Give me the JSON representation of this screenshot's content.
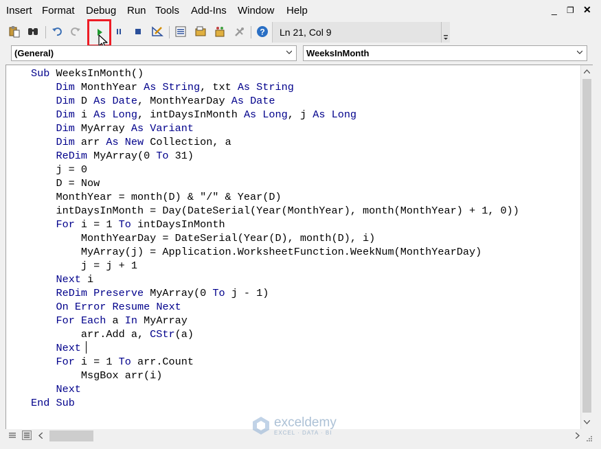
{
  "menu": {
    "items": [
      "Insert",
      "Format",
      "Debug",
      "Run",
      "Tools",
      "Add-Ins",
      "Window",
      "Help"
    ]
  },
  "window_controls": [
    "_",
    "▫",
    "✕"
  ],
  "toolbar": {
    "icons": [
      "paste-icon",
      "find-icon",
      "undo-icon",
      "redo-icon",
      "run-icon",
      "pause-icon",
      "reset-icon",
      "design-mode-icon",
      "project-explorer-icon",
      "properties-icon",
      "object-browser-icon",
      "toolbox-icon",
      "help-icon"
    ],
    "position": "Ln 21, Col 9",
    "highlight_color": "#ee1c25"
  },
  "combos": {
    "object": "(General)",
    "procedure": "WeeksInMonth"
  },
  "code": {
    "keyword_color": "#00008b",
    "lines": [
      [
        {
          "k": 1,
          "t": "Sub"
        },
        {
          "k": 0,
          "t": " WeeksInMonth()"
        }
      ],
      [
        {
          "k": 0,
          "t": "    "
        },
        {
          "k": 1,
          "t": "Dim"
        },
        {
          "k": 0,
          "t": " MonthYear "
        },
        {
          "k": 1,
          "t": "As"
        },
        {
          "k": 0,
          "t": " "
        },
        {
          "k": 1,
          "t": "String"
        },
        {
          "k": 0,
          "t": ", txt "
        },
        {
          "k": 1,
          "t": "As"
        },
        {
          "k": 0,
          "t": " "
        },
        {
          "k": 1,
          "t": "String"
        }
      ],
      [
        {
          "k": 0,
          "t": "    "
        },
        {
          "k": 1,
          "t": "Dim"
        },
        {
          "k": 0,
          "t": " D "
        },
        {
          "k": 1,
          "t": "As"
        },
        {
          "k": 0,
          "t": " "
        },
        {
          "k": 1,
          "t": "Date"
        },
        {
          "k": 0,
          "t": ", MonthYearDay "
        },
        {
          "k": 1,
          "t": "As"
        },
        {
          "k": 0,
          "t": " "
        },
        {
          "k": 1,
          "t": "Date"
        }
      ],
      [
        {
          "k": 0,
          "t": "    "
        },
        {
          "k": 1,
          "t": "Dim"
        },
        {
          "k": 0,
          "t": " i "
        },
        {
          "k": 1,
          "t": "As"
        },
        {
          "k": 0,
          "t": " "
        },
        {
          "k": 1,
          "t": "Long"
        },
        {
          "k": 0,
          "t": ", intDaysInMonth "
        },
        {
          "k": 1,
          "t": "As"
        },
        {
          "k": 0,
          "t": " "
        },
        {
          "k": 1,
          "t": "Long"
        },
        {
          "k": 0,
          "t": ", j "
        },
        {
          "k": 1,
          "t": "As"
        },
        {
          "k": 0,
          "t": " "
        },
        {
          "k": 1,
          "t": "Long"
        }
      ],
      [
        {
          "k": 0,
          "t": "    "
        },
        {
          "k": 1,
          "t": "Dim"
        },
        {
          "k": 0,
          "t": " MyArray "
        },
        {
          "k": 1,
          "t": "As"
        },
        {
          "k": 0,
          "t": " "
        },
        {
          "k": 1,
          "t": "Variant"
        }
      ],
      [
        {
          "k": 0,
          "t": "    "
        },
        {
          "k": 1,
          "t": "Dim"
        },
        {
          "k": 0,
          "t": " arr "
        },
        {
          "k": 1,
          "t": "As"
        },
        {
          "k": 0,
          "t": " "
        },
        {
          "k": 1,
          "t": "New"
        },
        {
          "k": 0,
          "t": " Collection, a"
        }
      ],
      [
        {
          "k": 0,
          "t": "    "
        },
        {
          "k": 1,
          "t": "ReDim"
        },
        {
          "k": 0,
          "t": " MyArray(0 "
        },
        {
          "k": 1,
          "t": "To"
        },
        {
          "k": 0,
          "t": " 31)"
        }
      ],
      [
        {
          "k": 0,
          "t": "    j = 0"
        }
      ],
      [
        {
          "k": 0,
          "t": "    D = Now"
        }
      ],
      [
        {
          "k": 0,
          "t": "    MonthYear = month(D) & \"/\" & Year(D)"
        }
      ],
      [
        {
          "k": 0,
          "t": "    intDaysInMonth = Day(DateSerial(Year(MonthYear), month(MonthYear) + 1, 0))"
        }
      ],
      [
        {
          "k": 0,
          "t": "    "
        },
        {
          "k": 1,
          "t": "For"
        },
        {
          "k": 0,
          "t": " i = 1 "
        },
        {
          "k": 1,
          "t": "To"
        },
        {
          "k": 0,
          "t": " intDaysInMonth"
        }
      ],
      [
        {
          "k": 0,
          "t": "        MonthYearDay = DateSerial(Year(D), month(D), i)"
        }
      ],
      [
        {
          "k": 0,
          "t": "        MyArray(j) = Application.WorksheetFunction.WeekNum(MonthYearDay)"
        }
      ],
      [
        {
          "k": 0,
          "t": "        j = j + 1"
        }
      ],
      [
        {
          "k": 0,
          "t": "    "
        },
        {
          "k": 1,
          "t": "Next"
        },
        {
          "k": 0,
          "t": " i"
        }
      ],
      [
        {
          "k": 0,
          "t": "    "
        },
        {
          "k": 1,
          "t": "ReDim"
        },
        {
          "k": 0,
          "t": " "
        },
        {
          "k": 1,
          "t": "Preserve"
        },
        {
          "k": 0,
          "t": " MyArray(0 "
        },
        {
          "k": 1,
          "t": "To"
        },
        {
          "k": 0,
          "t": " j - 1)"
        }
      ],
      [
        {
          "k": 0,
          "t": "    "
        },
        {
          "k": 1,
          "t": "On"
        },
        {
          "k": 0,
          "t": " "
        },
        {
          "k": 1,
          "t": "Error"
        },
        {
          "k": 0,
          "t": " "
        },
        {
          "k": 1,
          "t": "Resume"
        },
        {
          "k": 0,
          "t": " "
        },
        {
          "k": 1,
          "t": "Next"
        }
      ],
      [
        {
          "k": 0,
          "t": "    "
        },
        {
          "k": 1,
          "t": "For"
        },
        {
          "k": 0,
          "t": " "
        },
        {
          "k": 1,
          "t": "Each"
        },
        {
          "k": 0,
          "t": " a "
        },
        {
          "k": 1,
          "t": "In"
        },
        {
          "k": 0,
          "t": " MyArray"
        }
      ],
      [
        {
          "k": 0,
          "t": "        arr.Add a, "
        },
        {
          "k": 1,
          "t": "CStr"
        },
        {
          "k": 0,
          "t": "(a)"
        }
      ],
      [
        {
          "k": 0,
          "t": "    "
        },
        {
          "k": 1,
          "t": "Next"
        }
      ],
      [
        {
          "k": 0,
          "t": "    "
        },
        {
          "k": 1,
          "t": "For"
        },
        {
          "k": 0,
          "t": " i = 1 "
        },
        {
          "k": 1,
          "t": "To"
        },
        {
          "k": 0,
          "t": " arr.Count"
        }
      ],
      [
        {
          "k": 0,
          "t": "        MsgBox arr(i)"
        }
      ],
      [
        {
          "k": 0,
          "t": "    "
        },
        {
          "k": 1,
          "t": "Next"
        }
      ],
      [
        {
          "k": 1,
          "t": "End"
        },
        {
          "k": 0,
          "t": " "
        },
        {
          "k": 1,
          "t": "Sub"
        }
      ]
    ]
  },
  "watermark": {
    "name": "exceldemy",
    "tagline": "EXCEL · DATA · BI"
  }
}
